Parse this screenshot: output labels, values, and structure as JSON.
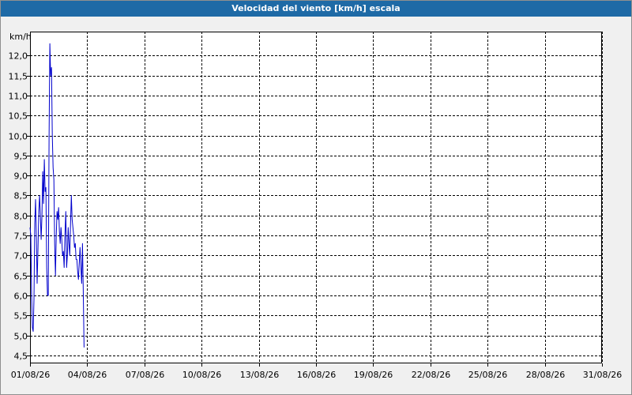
{
  "window": {
    "title": "Velocidad del viento [km/h] escala"
  },
  "colors": {
    "title_bar": "#1e6aa6",
    "series_line": "#0000cc",
    "grid": "#000000",
    "plot_background": "#ffffff",
    "window_background": "#f0f0f0"
  },
  "chart_data": {
    "type": "line",
    "title": "Velocidad del viento [km/h] escala",
    "xlabel": "",
    "ylabel": "km/h",
    "xlim": [
      "2026-08-01",
      "2026-08-31"
    ],
    "ylim": [
      4.3,
      12.6
    ],
    "grid": true,
    "x_tick_labels": [
      "01/08/26",
      "04/08/26",
      "07/08/26",
      "10/08/26",
      "13/08/26",
      "16/08/26",
      "19/08/26",
      "22/08/26",
      "25/08/26",
      "28/08/26",
      "31/08/26"
    ],
    "y_ticks": [
      4.5,
      5.0,
      5.5,
      6.0,
      6.5,
      7.0,
      7.5,
      8.0,
      8.5,
      9.0,
      9.5,
      10.0,
      10.5,
      11.0,
      11.5,
      12.0
    ],
    "y_tick_labels": [
      "4,5",
      "5,0",
      "5,5",
      "6,0",
      "6,5",
      "7,0",
      "7,5",
      "8,0",
      "8,5",
      "9,0",
      "9,5",
      "10,0",
      "10,5",
      "11,0",
      "11,5",
      "12,0"
    ],
    "series": [
      {
        "x": [
          "2026-08-01 00:00",
          "2026-08-01 01:00",
          "2026-08-01 02:00",
          "2026-08-01 03:00",
          "2026-08-01 04:00",
          "2026-08-01 05:00",
          "2026-08-01 06:00",
          "2026-08-01 07:00",
          "2026-08-01 08:00",
          "2026-08-01 09:00",
          "2026-08-01 10:00",
          "2026-08-01 11:00",
          "2026-08-01 12:00",
          "2026-08-01 13:00",
          "2026-08-01 14:00",
          "2026-08-01 15:00",
          "2026-08-01 16:00",
          "2026-08-01 17:00",
          "2026-08-01 18:00",
          "2026-08-01 19:00",
          "2026-08-01 20:00",
          "2026-08-01 21:00",
          "2026-08-01 22:00",
          "2026-08-01 23:00",
          "2026-08-02 00:00",
          "2026-08-02 01:00",
          "2026-08-02 02:00",
          "2026-08-02 03:00",
          "2026-08-02 04:00",
          "2026-08-02 05:00",
          "2026-08-02 06:00",
          "2026-08-02 07:00",
          "2026-08-02 08:00",
          "2026-08-02 09:00",
          "2026-08-02 10:00",
          "2026-08-02 11:00",
          "2026-08-02 12:00",
          "2026-08-02 13:00",
          "2026-08-02 14:00",
          "2026-08-02 15:00",
          "2026-08-02 16:00",
          "2026-08-02 17:00",
          "2026-08-02 18:00",
          "2026-08-02 19:00",
          "2026-08-02 20:00",
          "2026-08-02 21:00",
          "2026-08-02 22:00",
          "2026-08-02 23:00",
          "2026-08-03 00:00",
          "2026-08-03 01:00",
          "2026-08-03 02:00",
          "2026-08-03 03:00",
          "2026-08-03 04:00",
          "2026-08-03 05:00",
          "2026-08-03 06:00",
          "2026-08-03 07:00",
          "2026-08-03 08:00",
          "2026-08-03 09:00",
          "2026-08-03 10:00",
          "2026-08-03 11:00",
          "2026-08-03 12:00",
          "2026-08-03 13:00",
          "2026-08-03 14:00",
          "2026-08-03 15:00",
          "2026-08-03 16:00",
          "2026-08-03 17:00",
          "2026-08-03 18:00",
          "2026-08-03 19:00",
          "2026-08-03 20:00"
        ],
        "values": [
          7.7,
          7.5,
          6.0,
          5.2,
          5.1,
          5.9,
          7.8,
          8.4,
          7.5,
          6.3,
          7.2,
          8.1,
          8.5,
          8.0,
          7.4,
          8.0,
          9.1,
          8.3,
          9.4,
          8.6,
          8.7,
          6.7,
          6.0,
          6.0,
          9.9,
          12.3,
          11.5,
          11.7,
          10.0,
          9.2,
          8.9,
          7.3,
          6.5,
          7.5,
          8.1,
          7.9,
          8.2,
          7.6,
          7.3,
          7.7,
          7.4,
          7.0,
          7.1,
          6.7,
          7.5,
          8.1,
          6.7,
          7.0,
          7.7,
          7.3,
          7.0,
          7.8,
          8.5,
          7.9,
          7.7,
          7.5,
          7.2,
          7.3,
          6.9,
          6.9,
          6.6,
          6.4,
          6.8,
          7.2,
          6.7,
          6.3,
          7.3,
          6.1,
          4.7
        ]
      }
    ]
  }
}
